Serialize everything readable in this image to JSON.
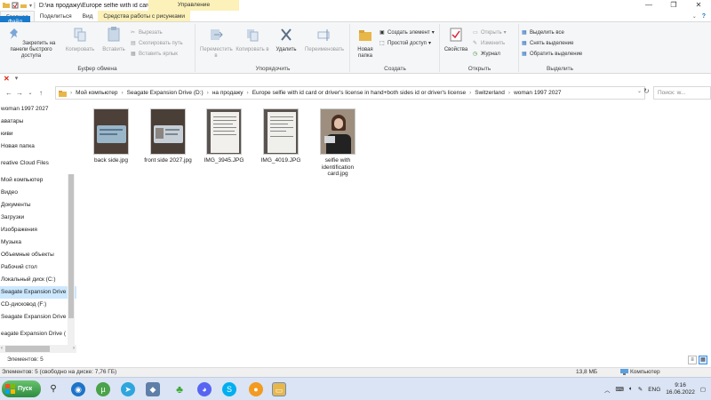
{
  "window": {
    "title": "D:\\на продажу\\Europe selfie with id card or ...",
    "context_title": "Управление",
    "controls": [
      "—",
      "❐",
      "✕"
    ]
  },
  "tabs": [
    {
      "label": "Файл",
      "kind": "file"
    },
    {
      "label": "Главная",
      "kind": "active"
    },
    {
      "label": "Поделиться",
      "kind": "normal"
    },
    {
      "label": "Вид",
      "kind": "normal"
    },
    {
      "label": "Средства работы с рисунками",
      "kind": "ctx"
    }
  ],
  "ribbon": {
    "clipboard": {
      "name": "Буфер обмена",
      "pin": "Закрепить на панели быстрого доступа",
      "copy": "Копировать",
      "paste": "Вставить",
      "cut": "Вырезать",
      "copy_path": "Скопировать путь",
      "paste_shortcut": "Вставить ярлык"
    },
    "organize": {
      "name": "Упорядочить",
      "move_to": "Переместить в",
      "copy_to": "Копировать в",
      "delete": "Удалить",
      "rename": "Переименовать"
    },
    "create": {
      "name": "Создать",
      "new_folder": "Новая папка",
      "new_item": "Создать элемент",
      "easy_access": "Простой доступ"
    },
    "open": {
      "name": "Открыть",
      "properties": "Свойства",
      "open": "Открыть",
      "edit": "Изменить",
      "history": "Журнал"
    },
    "select": {
      "name": "Выделить",
      "select_all": "Выделить все",
      "select_none": "Снять выделение",
      "invert": "Обратить выделение"
    }
  },
  "breadcrumb": [
    "Мой компьютер",
    "Seagate Expansion Drive (D:)",
    "на продажу",
    "Europe selfie with id card or driver's license in hand+both sides id or driver's license",
    "Switzerland",
    "woman 1997 2027"
  ],
  "search": {
    "placeholder": "Поиск: w..."
  },
  "sidebar": {
    "items": [
      {
        "label": "woman 1997 2027",
        "selected": false
      },
      {
        "label": "аватары",
        "selected": false
      },
      {
        "label": "киви",
        "selected": false
      },
      {
        "label": "Новая папка",
        "selected": false
      },
      {
        "label": "",
        "selected": false
      },
      {
        "label": "reative Cloud Files",
        "selected": false
      },
      {
        "label": "",
        "selected": false
      },
      {
        "label": "Мой компьютер",
        "selected": false
      },
      {
        "label": "Видео",
        "selected": false
      },
      {
        "label": "Документы",
        "selected": false
      },
      {
        "label": "Загрузки",
        "selected": false
      },
      {
        "label": "Изображения",
        "selected": false
      },
      {
        "label": "Музыка",
        "selected": false
      },
      {
        "label": "Объемные объекты",
        "selected": false
      },
      {
        "label": "Рабочий стол",
        "selected": false
      },
      {
        "label": "Локальный диск (C:)",
        "selected": false
      },
      {
        "label": "Seagate Expansion Drive",
        "selected": true
      },
      {
        "label": "CD-дисковод (F:)",
        "selected": false
      },
      {
        "label": "Seagate Expansion Drive",
        "selected": false
      },
      {
        "label": "",
        "selected": false
      },
      {
        "label": "eagate Expansion Drive (",
        "selected": false
      }
    ]
  },
  "files": [
    {
      "name": "back side.jpg",
      "kind": "id-card"
    },
    {
      "name": "front side 2027.jpg",
      "kind": "id-card"
    },
    {
      "name": "IMG_3945.JPG",
      "kind": "document"
    },
    {
      "name": "IMG_4019.JPG",
      "kind": "document"
    },
    {
      "name": "selfie with identification card.jpg",
      "kind": "selfie"
    }
  ],
  "status": {
    "count": "Элементов: 5",
    "details": "Элементов: 5 (свободно на диске: 7,76 ГБ)",
    "size": "13,8 МБ",
    "location": "Компьютер"
  },
  "taskbar": {
    "start": "Пуск",
    "lang": "ENG",
    "time": "9:16",
    "date": "16.06.2022"
  }
}
